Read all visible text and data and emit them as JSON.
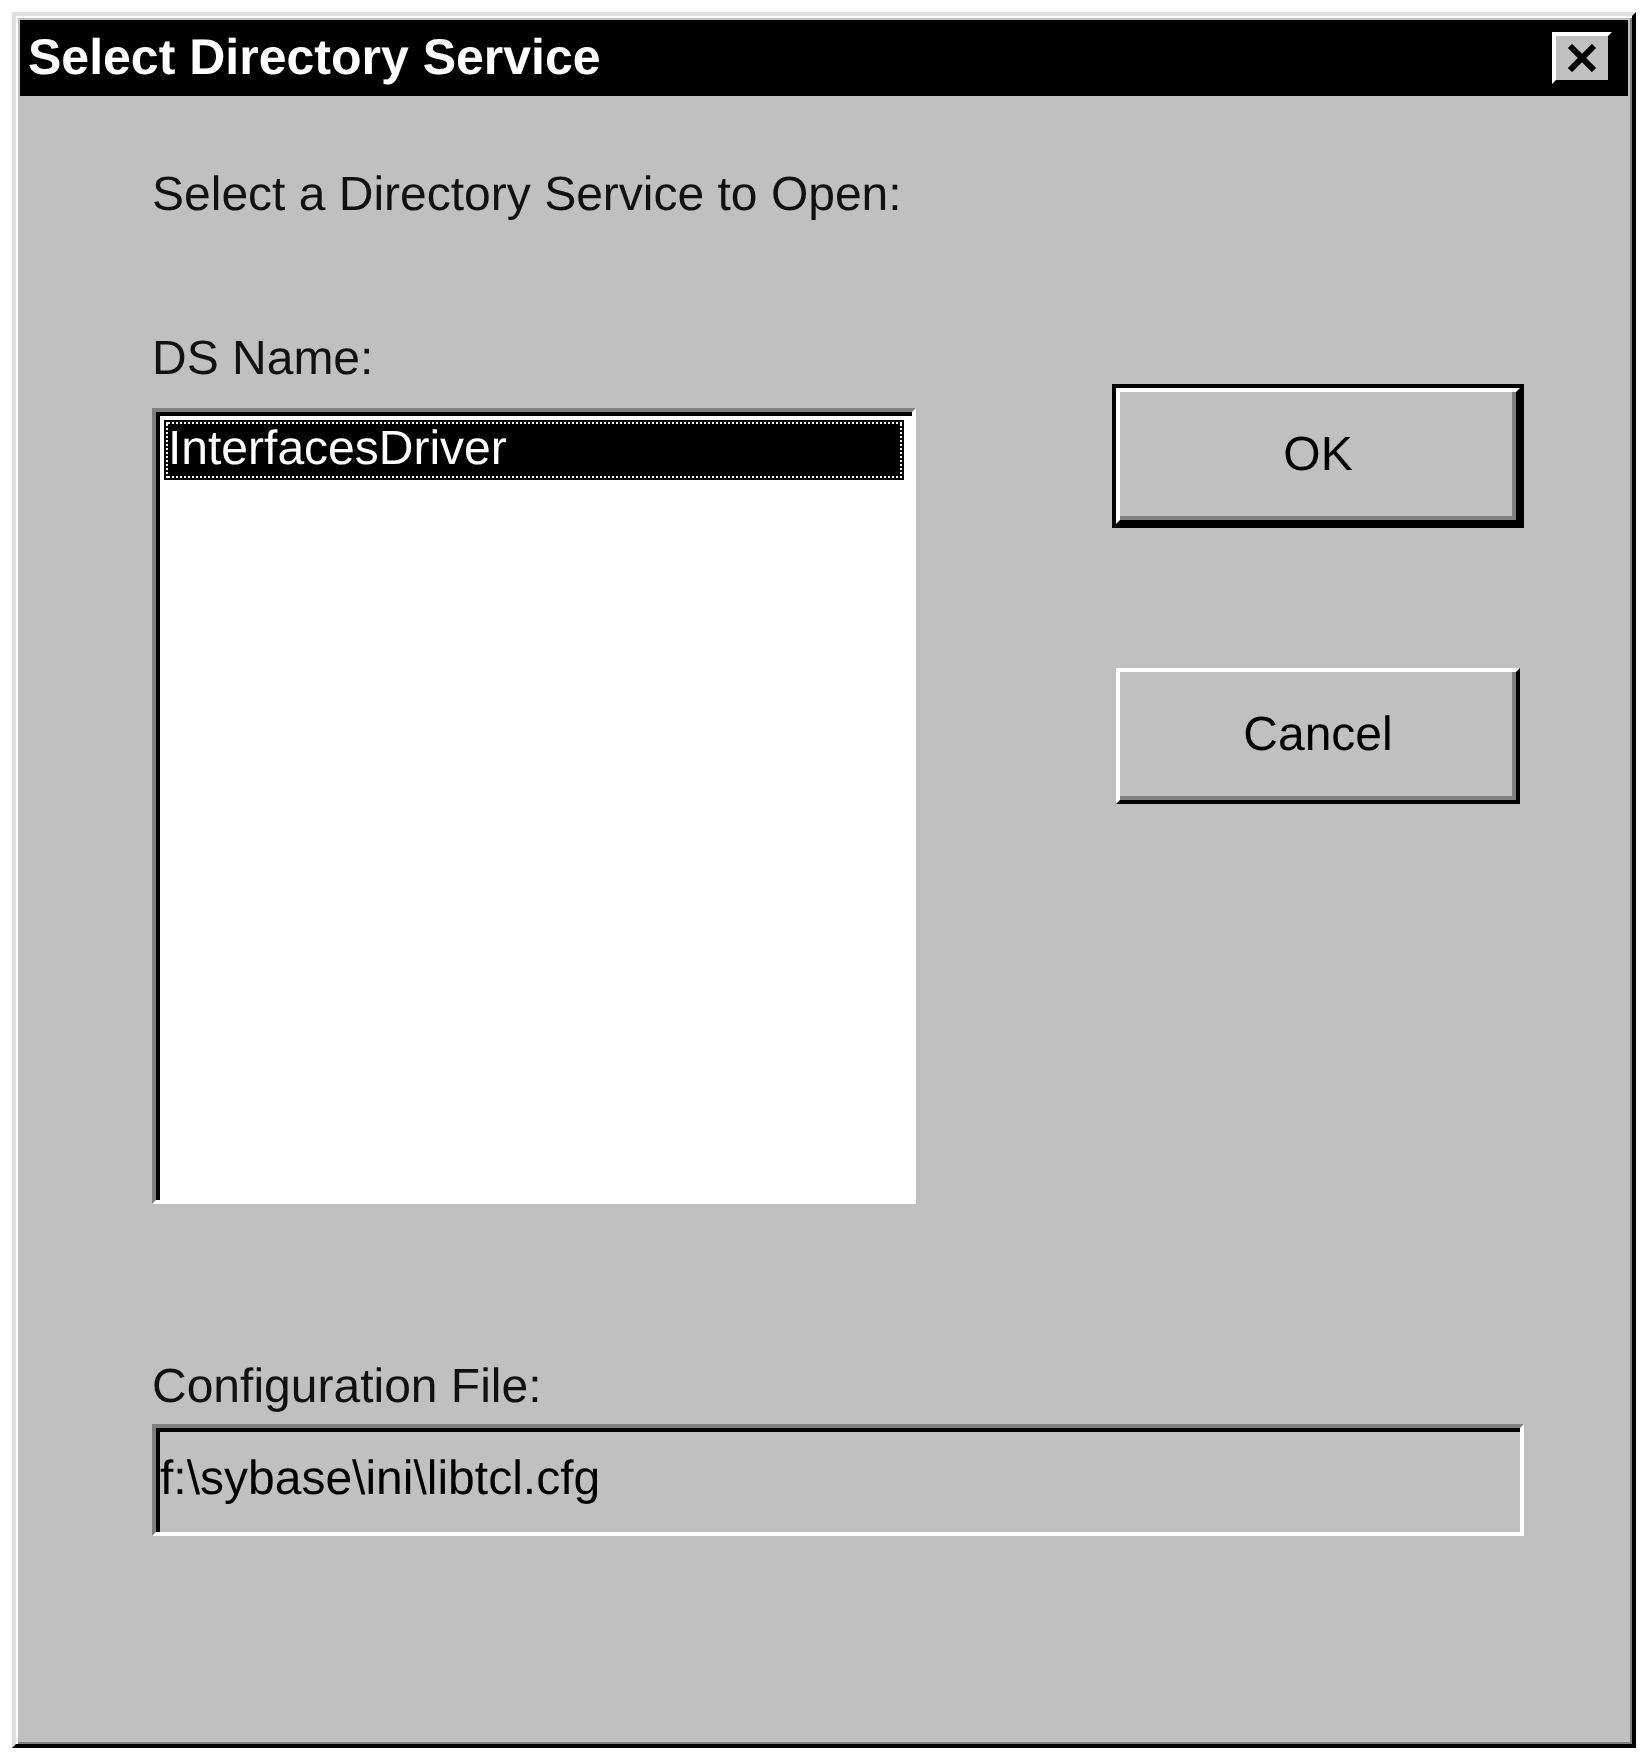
{
  "window": {
    "title": "Select Directory Service"
  },
  "prompt": "Select a Directory Service to Open:",
  "ds_list": {
    "label": "DS Name:",
    "items": [
      {
        "label": "InterfacesDriver",
        "selected": true
      }
    ]
  },
  "buttons": [
    {
      "label": "OK",
      "default": true
    },
    {
      "label": "Cancel",
      "default": false
    }
  ],
  "config": {
    "label": "Configuration File:",
    "value": "f:\\sybase\\ini\\libtcl.cfg",
    "disabled": true
  }
}
